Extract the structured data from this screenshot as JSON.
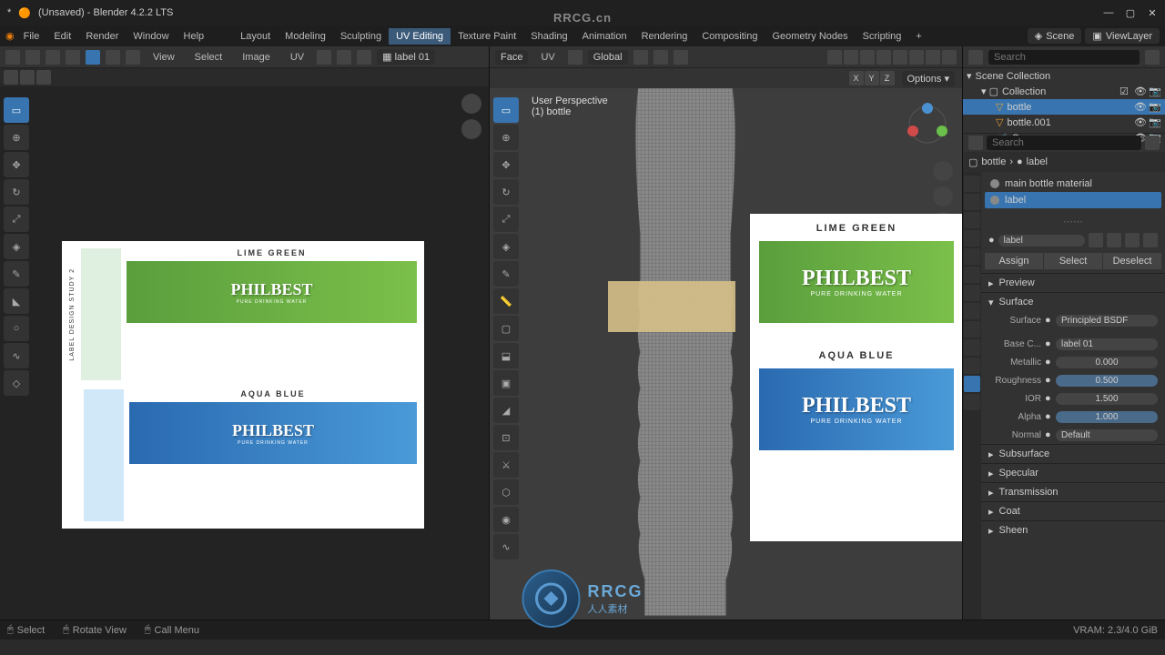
{
  "watermark": "RRCG.cn",
  "titlebar": {
    "title": "(Unsaved) - Blender 4.2.2 LTS",
    "modified": "*"
  },
  "menubar": {
    "logo": "blender",
    "items": [
      "File",
      "Edit",
      "Render",
      "Window",
      "Help"
    ],
    "workspaces": [
      "Layout",
      "Modeling",
      "Sculpting",
      "UV Editing",
      "Texture Paint",
      "Shading",
      "Animation",
      "Rendering",
      "Compositing",
      "Geometry Nodes",
      "Scripting"
    ],
    "active_workspace": "UV Editing",
    "scene": "Scene",
    "view_layer": "ViewLayer"
  },
  "uv_panel": {
    "header": {
      "view": "View",
      "select": "Select",
      "image": "Image",
      "uv": "UV",
      "image_name": "label 01"
    },
    "label_design": {
      "side_text": "LABEL DESIGN STUDY 2",
      "top_label": "LIME GREEN",
      "bottom_label": "AQUA BLUE",
      "brand": "PHILBEST",
      "tagline": "PURE DRINKING WATER"
    }
  },
  "viewport": {
    "header": {
      "mode": "Face",
      "uv": "UV",
      "orientation": "Global"
    },
    "options_label": "Options",
    "axes": [
      "X",
      "Y",
      "Z"
    ],
    "info": {
      "line1": "User Perspective",
      "line2": "(1) bottle"
    },
    "ref_image": {
      "top_label": "LIME GREEN",
      "bottom_label": "AQUA BLUE",
      "brand": "PHILBEST",
      "tagline": "PURE DRINKING WATER"
    }
  },
  "outliner": {
    "search_placeholder": "Search",
    "root": "Scene Collection",
    "collection": "Collection",
    "items": [
      {
        "name": "bottle",
        "selected": true
      },
      {
        "name": "bottle.001",
        "selected": false
      },
      {
        "name": "Camera",
        "selected": false
      }
    ]
  },
  "properties": {
    "search_placeholder": "Search",
    "breadcrumb": {
      "object": "bottle",
      "material": "label"
    },
    "materials": [
      {
        "name": "main bottle material",
        "selected": false
      },
      {
        "name": "label",
        "selected": true
      }
    ],
    "material_name": "label",
    "buttons": {
      "assign": "Assign",
      "select": "Select",
      "deselect": "Deselect"
    },
    "sections": {
      "preview": "Preview",
      "surface": "Surface",
      "subsurface": "Subsurface",
      "specular": "Specular",
      "transmission": "Transmission",
      "coat": "Coat",
      "sheen": "Sheen"
    },
    "surface": {
      "shader_label": "Surface",
      "shader": "Principled BSDF",
      "base_color_label": "Base C...",
      "base_color_value": "label 01",
      "metallic_label": "Metallic",
      "metallic": "0.000",
      "roughness_label": "Roughness",
      "roughness": "0.500",
      "ior_label": "IOR",
      "ior": "1.500",
      "alpha_label": "Alpha",
      "alpha": "1.000",
      "normal_label": "Normal",
      "normal": "Default"
    }
  },
  "statusbar": {
    "select": "Select",
    "rotate": "Rotate View",
    "menu": "Call Menu",
    "vram": "VRAM: 2.3/4.0 GiB"
  },
  "logo": {
    "text": "RRCG",
    "subtext": "人人素材"
  }
}
